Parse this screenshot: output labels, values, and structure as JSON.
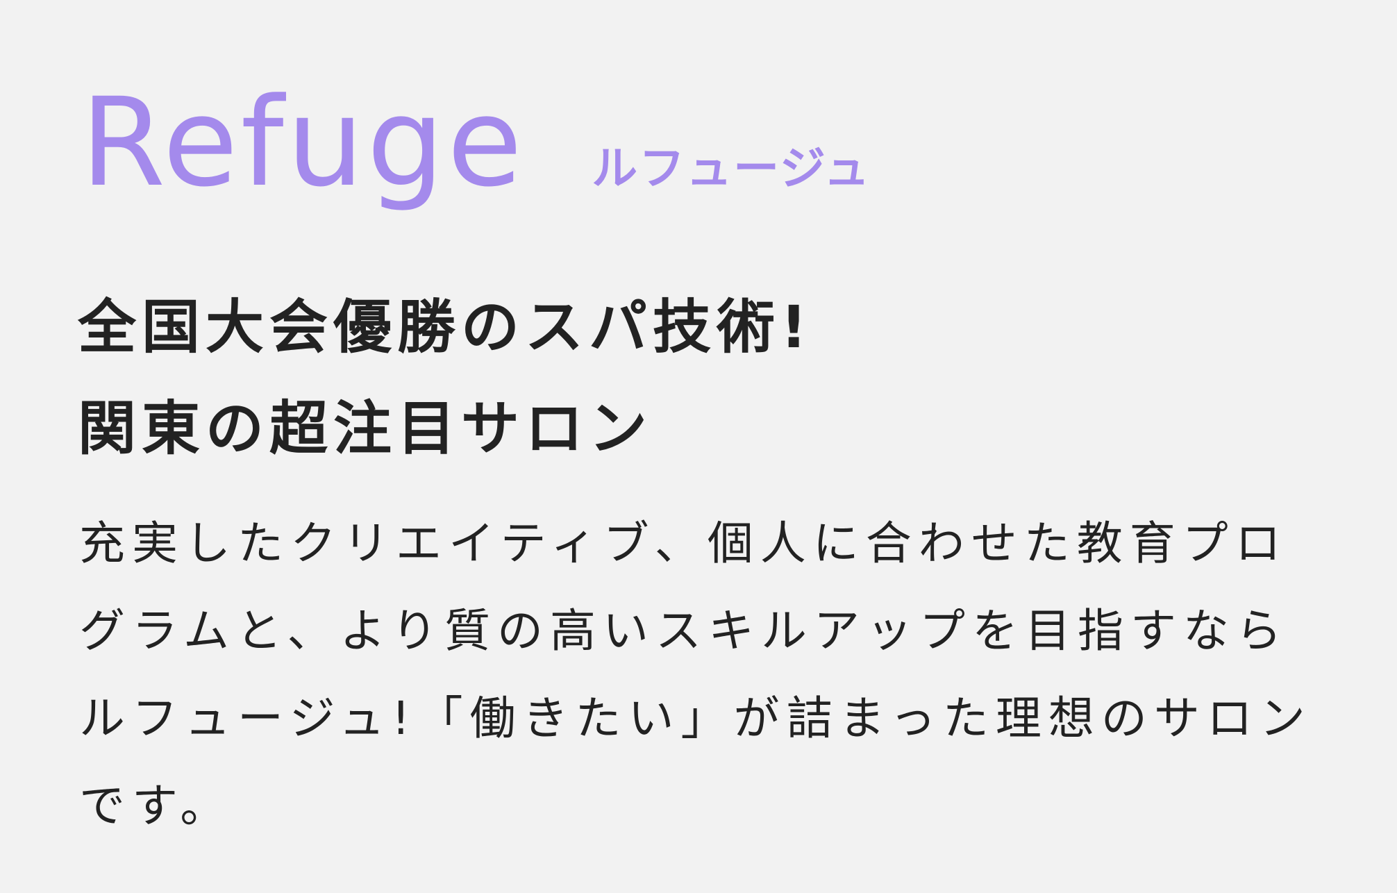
{
  "brand": {
    "name": "Refuge",
    "kana": "ルフュージュ",
    "accent_color": "#a48aec"
  },
  "headline": {
    "line1": "全国大会優勝のスパ技術!",
    "line2": "関東の超注目サロン"
  },
  "description": "充実したクリエイティブ、個人に合わせた教育プログラムと、より質の高いスキルアップを目指すならルフュージュ!「働きたい」が詰まった理想のサロンです。",
  "colors": {
    "background": "#f2f2f2",
    "text": "#222222"
  }
}
